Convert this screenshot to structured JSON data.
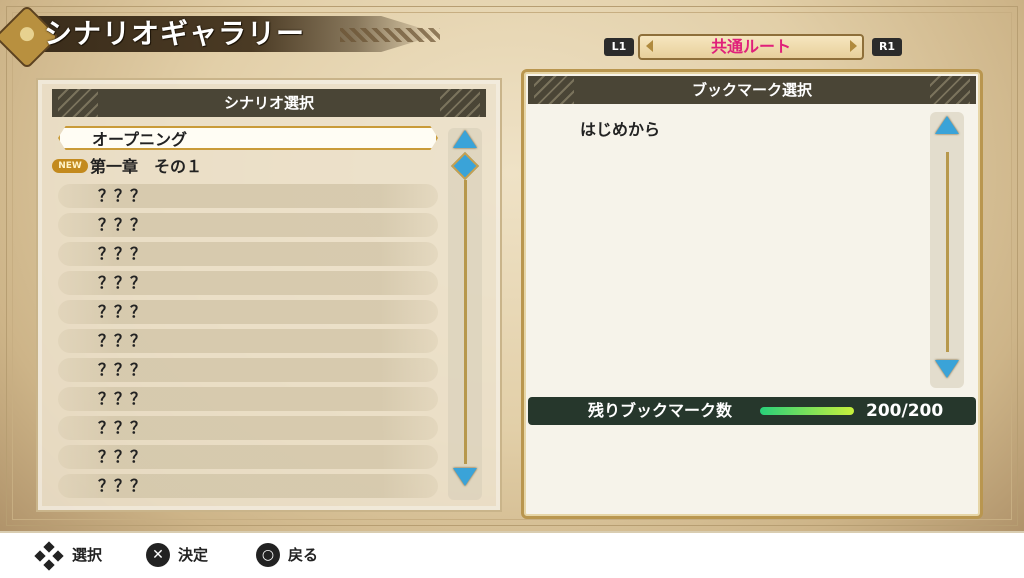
{
  "title": "シナリオギャラリー",
  "route_selector": {
    "left_button": "L1",
    "right_button": "R1",
    "label": "共通ルート"
  },
  "scenario_panel": {
    "header": "シナリオ選択",
    "items": [
      {
        "label": "オープニング",
        "state": "selected"
      },
      {
        "label": "第一章　その１",
        "badge": "NEW"
      },
      {
        "label": "？？？"
      },
      {
        "label": "？？？"
      },
      {
        "label": "？？？"
      },
      {
        "label": "？？？"
      },
      {
        "label": "？？？"
      },
      {
        "label": "？？？"
      },
      {
        "label": "？？？"
      },
      {
        "label": "？？？"
      },
      {
        "label": "？？？"
      },
      {
        "label": "？？？"
      },
      {
        "label": "？？？"
      }
    ]
  },
  "bookmark_panel": {
    "header": "ブックマーク選択",
    "items": [
      {
        "label": "はじめから"
      }
    ],
    "remaining": {
      "label": "残りブックマーク数",
      "count": "200/200",
      "fill_fraction": 1.0
    }
  },
  "footer": {
    "hints": [
      {
        "icon": "dpad-icon",
        "label": "選択"
      },
      {
        "icon": "cross-button-icon",
        "glyph": "✕",
        "label": "決定"
      },
      {
        "icon": "circle-button-icon",
        "glyph": "○",
        "label": "戻る"
      }
    ]
  },
  "colors": {
    "route_text": "#e0207a",
    "header_bg": "#4a4536",
    "accent_gold": "#c99b39",
    "scroll_arrow": "#3aa3d8",
    "gauge_start": "#29d07a",
    "gauge_end": "#c8f03c"
  }
}
